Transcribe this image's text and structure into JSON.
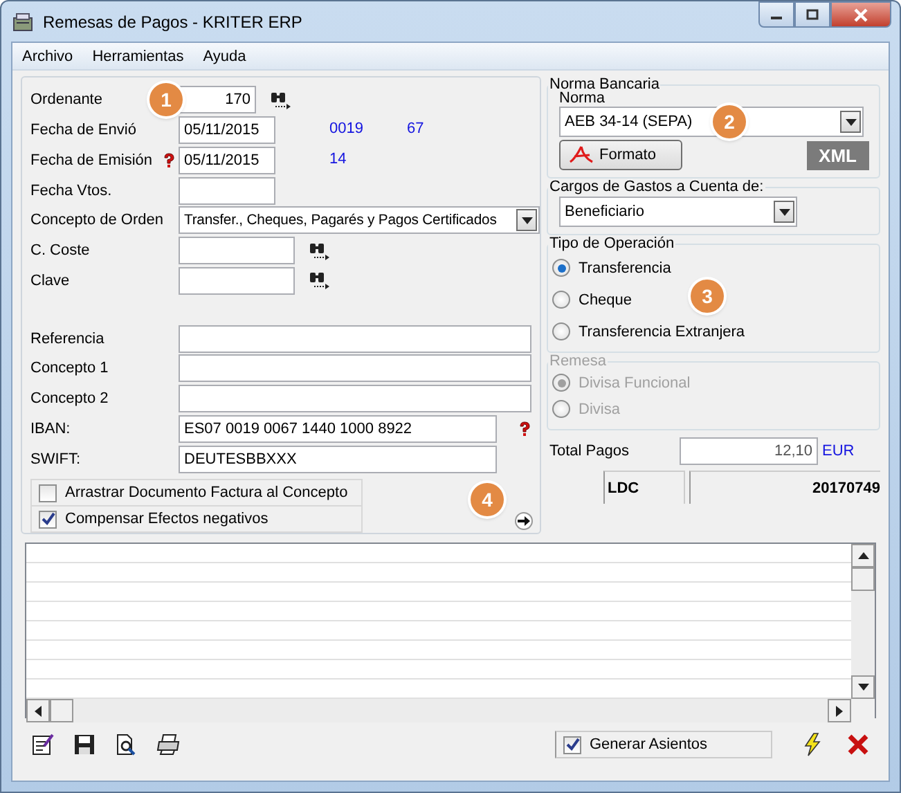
{
  "window": {
    "title": "Remesas de Pagos - KRITER ERP"
  },
  "menu": [
    "Archivo",
    "Herramientas",
    "Ayuda"
  ],
  "callouts": [
    "1",
    "2",
    "3",
    "4"
  ],
  "fields": [
    {
      "label": "Ordenante",
      "value": "170",
      "kind": "number"
    },
    {
      "label": "Fecha de Envió",
      "value": "05/11/2015",
      "kind": "text",
      "codes": [
        "0019",
        "67"
      ]
    },
    {
      "label": "Fecha de Emisión",
      "value": "05/11/2015",
      "kind": "text",
      "codes": [
        "14"
      ]
    },
    {
      "label": "Fecha Vtos.",
      "kind": "text"
    },
    {
      "label": "Concepto de Orden",
      "value": "Transfer., Cheques, Pagarés y Pagos Certificados",
      "kind": "select"
    },
    {
      "label": "C. Coste",
      "kind": "text"
    },
    {
      "label": "Clave",
      "kind": "text"
    },
    {
      "label": "Referencia",
      "kind": "text"
    },
    {
      "label": "Concepto 1",
      "kind": "text"
    },
    {
      "label": "Concepto 2",
      "kind": "text"
    },
    {
      "label": "IBAN:",
      "value": "ES07 0019 0067 1440 1000 8922",
      "kind": "text"
    },
    {
      "label": "SWIFT:",
      "value": "DEUTESBBXXX",
      "kind": "text"
    }
  ],
  "options": [
    {
      "label": "Arrastrar Documento Factura al Concepto",
      "checked": false
    },
    {
      "label": "Compensar Efectos negativos",
      "checked": true
    }
  ],
  "norma_bancaria": {
    "title": "Norma Bancaria",
    "norma_label": "Norma",
    "norma": "AEB 34-14 (SEPA)",
    "formato_button": "Formato",
    "xml_label": "XML"
  },
  "cargos": {
    "title": "Cargos de Gastos a Cuenta de:",
    "value": "Beneficiario"
  },
  "tipo_operacion": {
    "title": "Tipo de Operación",
    "options": [
      {
        "label": "Transferencia",
        "selected": true
      },
      {
        "label": "Cheque",
        "selected": false
      },
      {
        "label": "Transferencia Extranjera",
        "selected": false
      }
    ]
  },
  "remesa": {
    "title": "Remesa",
    "disabled": true,
    "options": [
      {
        "label": "Divisa Funcional",
        "selected": true
      },
      {
        "label": "Divisa",
        "selected": false
      }
    ]
  },
  "total_pagos": {
    "label": "Total Pagos",
    "value": "12,10",
    "currency": "EUR"
  },
  "ldc": {
    "label": "LDC",
    "value": "20170749"
  },
  "generar_asientos": {
    "label": "Generar Asientos",
    "checked": true
  }
}
